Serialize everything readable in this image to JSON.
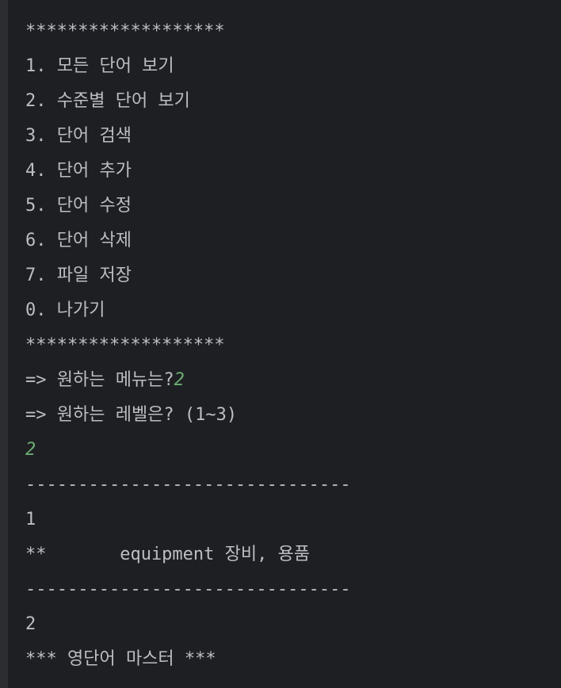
{
  "console": {
    "lines": [
      {
        "text": "*******************"
      },
      {
        "text": "1. 모든 단어 보기"
      },
      {
        "text": "2. 수준별 단어 보기"
      },
      {
        "text": "3. 단어 검색"
      },
      {
        "text": "4. 단어 추가"
      },
      {
        "text": "5. 단어 수정"
      },
      {
        "text": "6. 단어 삭제"
      },
      {
        "text": "7. 파일 저장"
      },
      {
        "text": "0. 나가기"
      },
      {
        "text": "*******************"
      },
      {
        "text": "=> 원하는 메뉴는?",
        "input": "2"
      },
      {
        "text": "=> 원하는 레벨은? (1~3)"
      },
      {
        "text": "",
        "input": "2"
      },
      {
        "text": "-------------------------------"
      },
      {
        "text": "1"
      },
      {
        "text": "**       equipment 장비, 용품"
      },
      {
        "text": "-------------------------------"
      },
      {
        "text": "2"
      },
      {
        "text": "*** 영단어 마스터 ***"
      }
    ]
  },
  "colors": {
    "background": "#1e1f22",
    "gutter": "#2b2d30",
    "text": "#bcbec4",
    "user_input": "#6aab73"
  }
}
